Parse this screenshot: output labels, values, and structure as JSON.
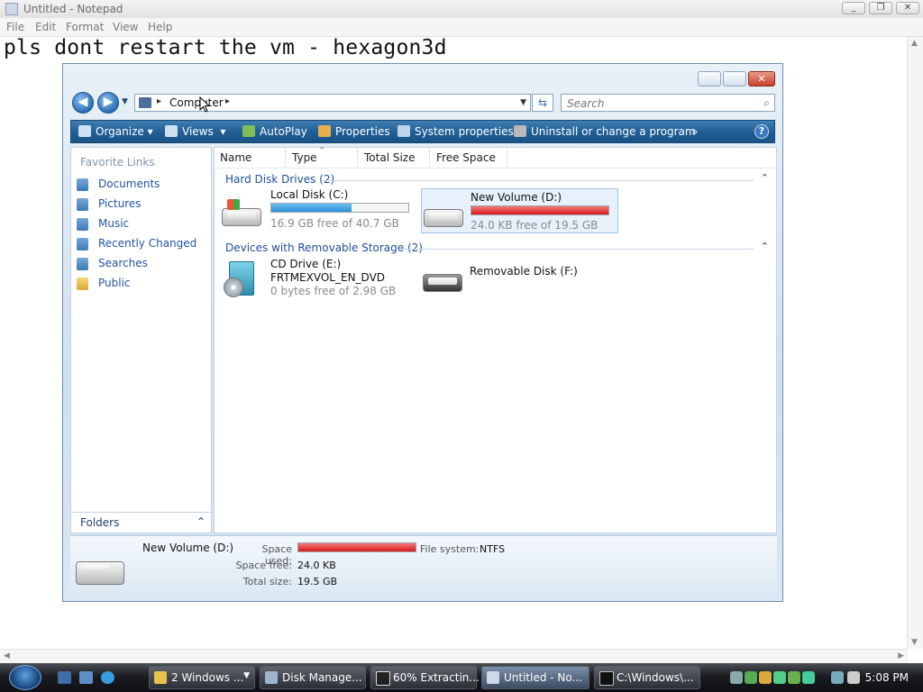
{
  "notepad": {
    "title": "Untitled - Notepad",
    "menu": [
      "File",
      "Edit",
      "Format",
      "View",
      "Help"
    ],
    "content": "pls dont restart the vm - hexagon3d"
  },
  "explorer": {
    "address": "Computer",
    "search_placeholder": "Search",
    "toolbar": {
      "organize": "Organize",
      "views": "Views",
      "autoplay": "AutoPlay",
      "properties": "Properties",
      "system_properties": "System properties",
      "uninstall": "Uninstall or change a program",
      "more": "»"
    },
    "favorites": {
      "title": "Favorite Links",
      "items": [
        "Documents",
        "Pictures",
        "Music",
        "Recently Changed",
        "Searches",
        "Public"
      ]
    },
    "folders_label": "Folders",
    "columns": [
      "Name",
      "Type",
      "Total Size",
      "Free Space"
    ],
    "groups": {
      "hdd": "Hard Disk Drives (2)",
      "removable": "Devices with Removable Storage (2)"
    },
    "drives": {
      "c": {
        "name": "Local Disk (C:)",
        "free_text": "16.9 GB free of 40.7 GB",
        "used_fraction": 0.585
      },
      "d": {
        "name": "New Volume (D:)",
        "free_text": "24.0 KB free of 19.5 GB",
        "used_fraction": 1.0
      },
      "e": {
        "name": "CD Drive (E:)",
        "label": "FRTMEXVOL_EN_DVD",
        "free_text": "0 bytes free of 2.98 GB"
      },
      "f": {
        "name": "Removable Disk (F:)"
      }
    },
    "details": {
      "name": "New Volume (D:)",
      "space_used_label": "Space used:",
      "space_free_label": "Space free:",
      "space_free": "24.0 KB",
      "total_size_label": "Total size:",
      "total_size": "19.5 GB",
      "file_system_label": "File system:",
      "file_system": "NTFS",
      "used_fraction": 1.0
    }
  },
  "taskbar": {
    "tasks": [
      "2 Windows ...",
      "Disk Manage...",
      "60% Extractin...",
      "Untitled - No...",
      "C:\\Windows\\..."
    ],
    "clock": "5:08 PM"
  },
  "colors": {
    "c_bar": "#2a8ed8",
    "d_bar": "#d81818",
    "link": "#1f55a6"
  }
}
